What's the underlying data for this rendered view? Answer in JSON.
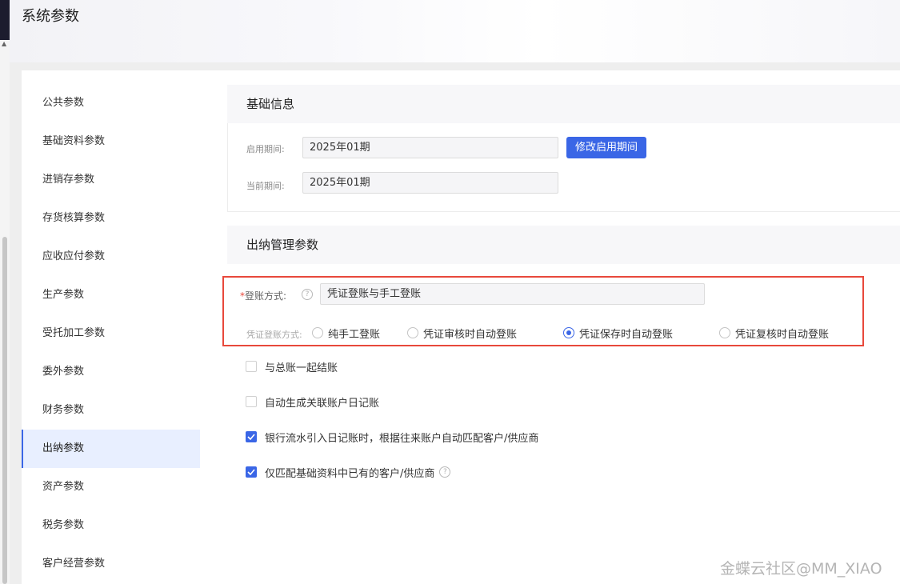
{
  "header": {
    "title": "系统参数"
  },
  "sidebar": {
    "items": [
      {
        "label": "公共参数"
      },
      {
        "label": "基础资料参数"
      },
      {
        "label": "进销存参数"
      },
      {
        "label": "存货核算参数"
      },
      {
        "label": "应收应付参数"
      },
      {
        "label": "生产参数"
      },
      {
        "label": "受托加工参数"
      },
      {
        "label": "委外参数"
      },
      {
        "label": "财务参数"
      },
      {
        "label": "出纳参数"
      },
      {
        "label": "资产参数"
      },
      {
        "label": "税务参数"
      },
      {
        "label": "客户经营参数"
      }
    ],
    "active_label": "出纳参数"
  },
  "basic_info": {
    "title": "基础信息",
    "start_period_label": "启用期间:",
    "start_period_value": "2025年01期",
    "modify_button": "修改启用期间",
    "current_period_label": "当前期间:",
    "current_period_value": "2025年01期"
  },
  "cashier": {
    "title": "出纳管理参数",
    "posting_method": {
      "required_mark": "*",
      "label": "登账方式:",
      "help": "?",
      "value": "凭证登账与手工登账"
    },
    "voucher_posting": {
      "label": "凭证登账方式:",
      "options": [
        {
          "label": "纯手工登账",
          "checked": false
        },
        {
          "label": "凭证审核时自动登账",
          "checked": false
        },
        {
          "label": "凭证保存时自动登账",
          "checked": true
        },
        {
          "label": "凭证复核时自动登账",
          "checked": false
        }
      ]
    },
    "checkboxes": [
      {
        "label": "与总账一起结账",
        "checked": false
      },
      {
        "label": "自动生成关联账户日记账",
        "checked": false
      },
      {
        "label": "银行流水引入日记账时，根据往来账户自动匹配客户/供应商",
        "checked": true
      },
      {
        "label": "仅匹配基础资料中已有的客户/供应商",
        "checked": true,
        "help": "?"
      }
    ]
  },
  "watermark": "金蝶云社区@MM_XIAO",
  "colors": {
    "accent": "#3a66e6",
    "highlight_frame": "#e8483b",
    "active_nav_bg": "#e8efff"
  }
}
